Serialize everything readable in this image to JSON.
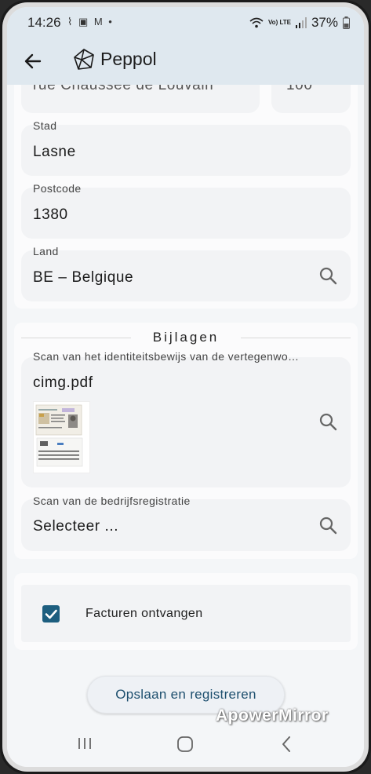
{
  "status_bar": {
    "time": "14:26",
    "notification_icons": "⌇ ▣ M •",
    "battery": "37%",
    "net_badge": "Vo) LTE"
  },
  "header": {
    "title": "Peppol"
  },
  "address": {
    "street_partial": "rue Chaussée de Louvain",
    "number_partial": "100",
    "city_label": "Stad",
    "city_value": "Lasne",
    "postcode_label": "Postcode",
    "postcode_value": "1380",
    "country_label": "Land",
    "country_value": "BE – Belgique"
  },
  "attachments": {
    "section_title": "Bijlagen",
    "id_scan_label": "Scan van het identiteitsbewijs van de vertegenwo…",
    "id_scan_file": "cimg.pdf",
    "registration_label": "Scan van de bedrijfsregistratie",
    "registration_value": "Selecteer ..."
  },
  "options": {
    "receive_invoices_label": "Facturen ontvangen",
    "receive_invoices_checked": true
  },
  "actions": {
    "save_label": "Opslaan en registreren"
  },
  "watermark": "ApowerMirror",
  "colors": {
    "header_bg": "#dfe8ef",
    "accent": "#1d5e7f",
    "button_text": "#1d4f6e"
  }
}
